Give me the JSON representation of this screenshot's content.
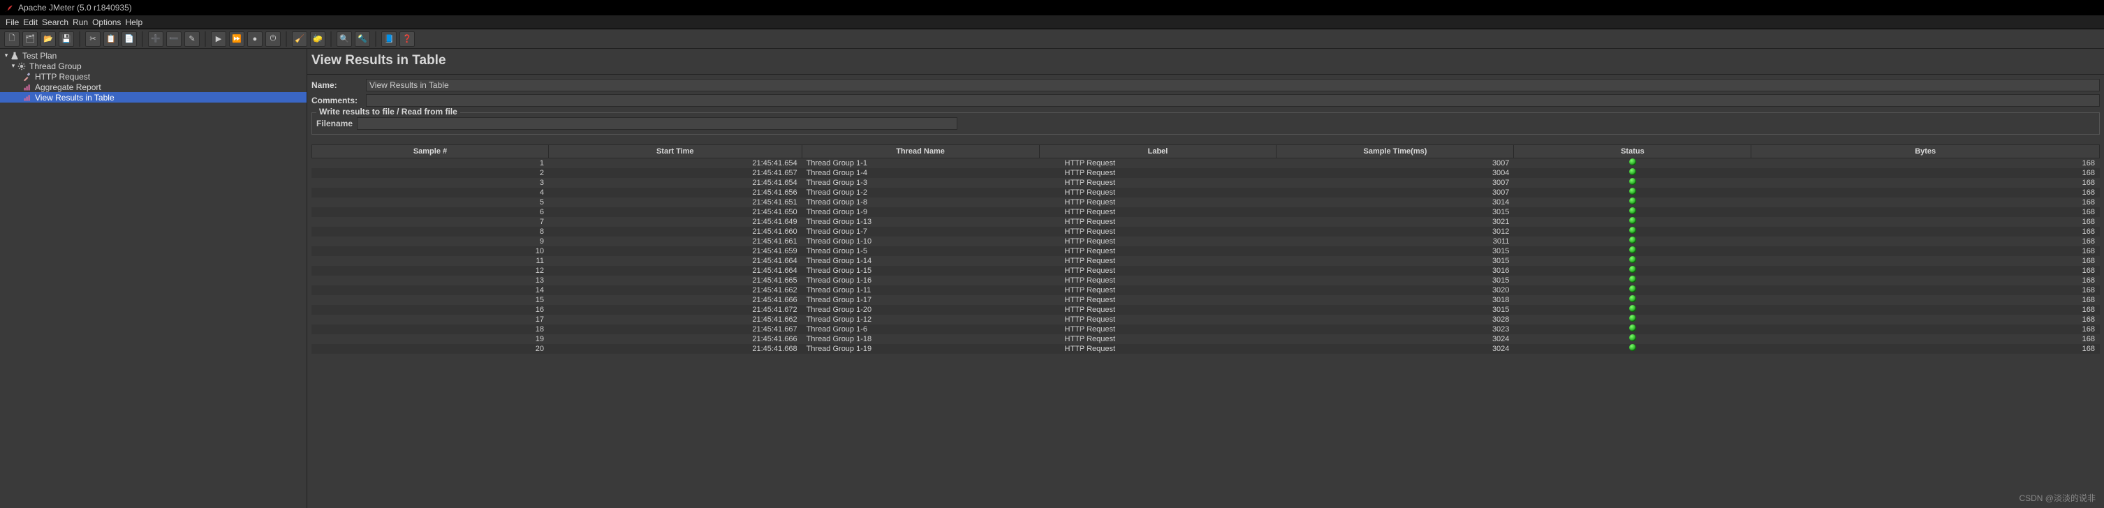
{
  "window": {
    "title": "Apache JMeter (5.0 r1840935)"
  },
  "menu": [
    "File",
    "Edit",
    "Search",
    "Run",
    "Options",
    "Help"
  ],
  "toolbar_groups": [
    [
      "new",
      "templates",
      "open",
      "save"
    ],
    [
      "cut",
      "copy",
      "paste"
    ],
    [
      "expand",
      "collapse",
      "toggle"
    ],
    [
      "start",
      "start-no-timers",
      "stop",
      "shutdown"
    ],
    [
      "clear",
      "clear-all"
    ],
    [
      "search-tree",
      "search-reset"
    ],
    [
      "fn-helper",
      "help"
    ]
  ],
  "toolbar_glyphs": {
    "new": "🗋",
    "templates": "🗂",
    "open": "📂",
    "save": "💾",
    "cut": "✂",
    "copy": "📋",
    "paste": "📄",
    "expand": "➕",
    "collapse": "➖",
    "toggle": "✎",
    "start": "▶",
    "start-no-timers": "⏩",
    "stop": "●",
    "shutdown": "⏻",
    "clear": "🧹",
    "clear-all": "🧽",
    "search-tree": "🔍",
    "search-reset": "🔦",
    "fn-helper": "📘",
    "help": "❓"
  },
  "tree": {
    "root": "Test Plan",
    "thread_group": "Thread Group",
    "children": [
      {
        "name": "HTTP Request",
        "icon": "pipette"
      },
      {
        "name": "Aggregate Report",
        "icon": "graph"
      },
      {
        "name": "View Results in Table",
        "icon": "graph",
        "selected": true
      }
    ]
  },
  "panel": {
    "title": "View Results in Table",
    "name_label": "Name:",
    "name_value": "View Results in Table",
    "comments_label": "Comments:",
    "group_legend": "Write results to file / Read from file",
    "filename_label": "Filename"
  },
  "columns": [
    "Sample #",
    "Start Time",
    "Thread Name",
    "Label",
    "Sample Time(ms)",
    "Status",
    "Bytes"
  ],
  "rows": [
    {
      "n": 1,
      "t": "21:45:41.654",
      "th": "Thread Group 1-1",
      "l": "HTTP Request",
      "ms": 3007,
      "b": 168
    },
    {
      "n": 2,
      "t": "21:45:41.657",
      "th": "Thread Group 1-4",
      "l": "HTTP Request",
      "ms": 3004,
      "b": 168
    },
    {
      "n": 3,
      "t": "21:45:41.654",
      "th": "Thread Group 1-3",
      "l": "HTTP Request",
      "ms": 3007,
      "b": 168
    },
    {
      "n": 4,
      "t": "21:45:41.656",
      "th": "Thread Group 1-2",
      "l": "HTTP Request",
      "ms": 3007,
      "b": 168
    },
    {
      "n": 5,
      "t": "21:45:41.651",
      "th": "Thread Group 1-8",
      "l": "HTTP Request",
      "ms": 3014,
      "b": 168
    },
    {
      "n": 6,
      "t": "21:45:41.650",
      "th": "Thread Group 1-9",
      "l": "HTTP Request",
      "ms": 3015,
      "b": 168
    },
    {
      "n": 7,
      "t": "21:45:41.649",
      "th": "Thread Group 1-13",
      "l": "HTTP Request",
      "ms": 3021,
      "b": 168
    },
    {
      "n": 8,
      "t": "21:45:41.660",
      "th": "Thread Group 1-7",
      "l": "HTTP Request",
      "ms": 3012,
      "b": 168
    },
    {
      "n": 9,
      "t": "21:45:41.661",
      "th": "Thread Group 1-10",
      "l": "HTTP Request",
      "ms": 3011,
      "b": 168
    },
    {
      "n": 10,
      "t": "21:45:41.659",
      "th": "Thread Group 1-5",
      "l": "HTTP Request",
      "ms": 3015,
      "b": 168
    },
    {
      "n": 11,
      "t": "21:45:41.664",
      "th": "Thread Group 1-14",
      "l": "HTTP Request",
      "ms": 3015,
      "b": 168
    },
    {
      "n": 12,
      "t": "21:45:41.664",
      "th": "Thread Group 1-15",
      "l": "HTTP Request",
      "ms": 3016,
      "b": 168
    },
    {
      "n": 13,
      "t": "21:45:41.665",
      "th": "Thread Group 1-16",
      "l": "HTTP Request",
      "ms": 3015,
      "b": 168
    },
    {
      "n": 14,
      "t": "21:45:41.662",
      "th": "Thread Group 1-11",
      "l": "HTTP Request",
      "ms": 3020,
      "b": 168
    },
    {
      "n": 15,
      "t": "21:45:41.666",
      "th": "Thread Group 1-17",
      "l": "HTTP Request",
      "ms": 3018,
      "b": 168
    },
    {
      "n": 16,
      "t": "21:45:41.672",
      "th": "Thread Group 1-20",
      "l": "HTTP Request",
      "ms": 3015,
      "b": 168
    },
    {
      "n": 17,
      "t": "21:45:41.662",
      "th": "Thread Group 1-12",
      "l": "HTTP Request",
      "ms": 3028,
      "b": 168
    },
    {
      "n": 18,
      "t": "21:45:41.667",
      "th": "Thread Group 1-6",
      "l": "HTTP Request",
      "ms": 3023,
      "b": 168
    },
    {
      "n": 19,
      "t": "21:45:41.666",
      "th": "Thread Group 1-18",
      "l": "HTTP Request",
      "ms": 3024,
      "b": 168
    },
    {
      "n": 20,
      "t": "21:45:41.668",
      "th": "Thread Group 1-19",
      "l": "HTTP Request",
      "ms": 3024,
      "b": 168
    }
  ],
  "watermark": "CSDN @淡淡的说非"
}
